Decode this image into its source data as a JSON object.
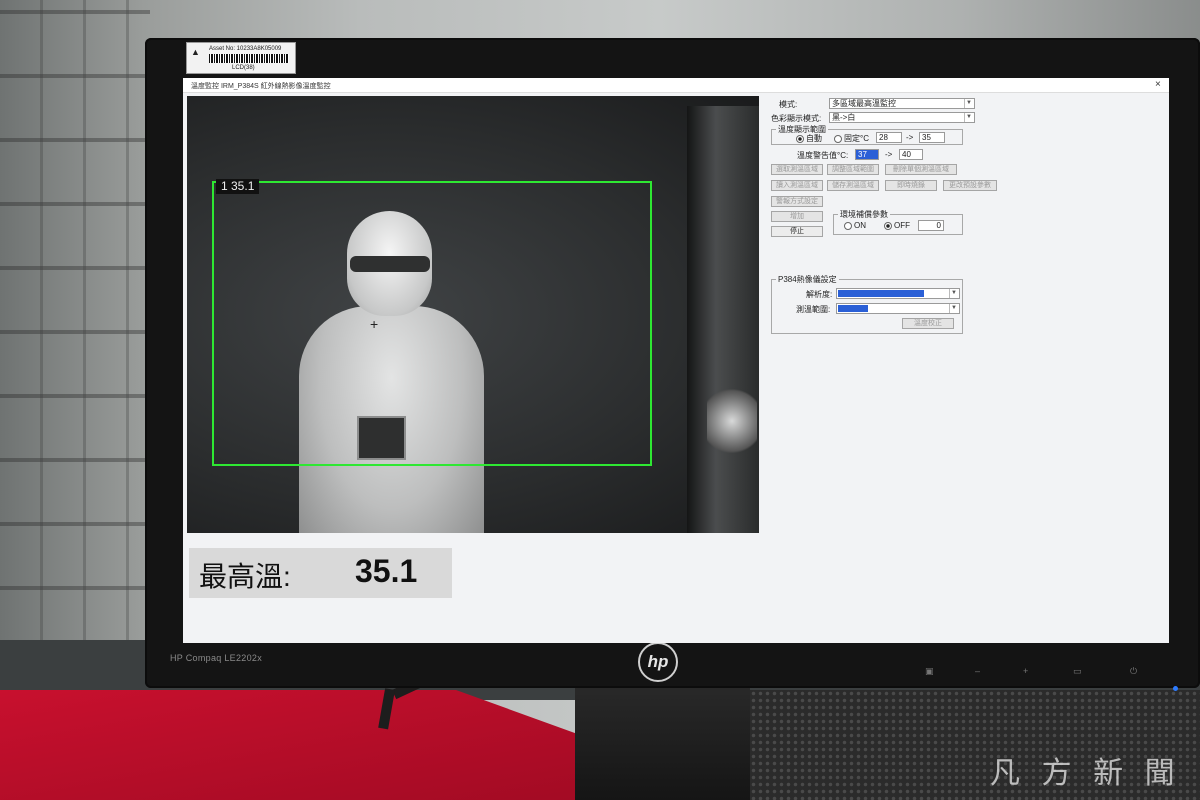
{
  "asset_label": {
    "line1": "Asset No:   10233A8K05009",
    "line2": "LCD(38)"
  },
  "monitor": {
    "model": "HP Compaq LE2202x",
    "brand": "hp"
  },
  "window": {
    "title": "溫度監控 IRM_P384S 紅外線熱影像溫度監控",
    "close_symbol": "×"
  },
  "thermal_view": {
    "detection_label": "1  35.1",
    "crosshair": "+",
    "box_color": "#2ee832"
  },
  "max_temp": {
    "label": "最高溫:",
    "value": "35.1"
  },
  "panel": {
    "mode_label": "模式:",
    "mode_value": "多區域最高溫監控",
    "color_mode_label": "色彩顯示模式:",
    "color_mode_value": "黑->白",
    "temp_range_group": "溫度顯示範圍",
    "auto_label": "自動",
    "fixed_label": "固定°C",
    "range_min": "28",
    "range_arrow": "->",
    "range_max": "35",
    "alarm_label": "溫度警告值°C:",
    "alarm_min": "37",
    "alarm_max": "40",
    "buttons_row1": [
      "選取測溫區域",
      "調整區域範圍",
      "刪除單個測溫區域"
    ],
    "buttons_row2": [
      "讀入測溫區域",
      "儲存測溫區域",
      "即時燒錄",
      "更改預設參數"
    ],
    "alarm_method_button": "警報方式設定",
    "add_button": "增加",
    "stop_button": "停止",
    "env_group": "環境補償參數",
    "on_label": "ON",
    "off_label": "OFF",
    "env_value": "0",
    "camera_group": "P384熱像儀設定",
    "resolution_label": "解析度:",
    "measure_range_label": "測溫範圍:",
    "calibrate_button": "溫度校正",
    "selection_color": "#2a5fd6"
  },
  "watermark": "凡 方 新 聞"
}
